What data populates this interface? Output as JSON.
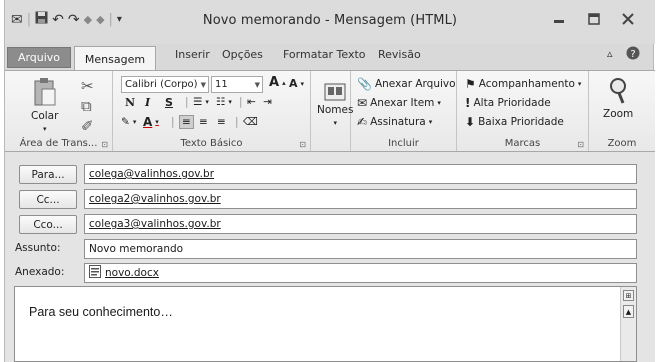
{
  "window": {
    "title": "Novo memorando - Mensagem (HTML)"
  },
  "tabs": {
    "file": "Arquivo",
    "active": "Mensagem",
    "others": [
      "Inserir",
      "Opções",
      "Formatar Texto",
      "Revisão"
    ]
  },
  "ribbon": {
    "clipboard": {
      "paste": "Colar",
      "label": "Área de Trans..."
    },
    "text": {
      "font": "Calibri (Corpo)",
      "size": "11",
      "bold": "N",
      "italic": "I",
      "underline": "S",
      "label": "Texto Básico"
    },
    "names": {
      "label": "Nomes"
    },
    "include": {
      "attach_file": "Anexar Arquivo",
      "attach_item": "Anexar Item",
      "signature": "Assinatura",
      "label": "Incluir"
    },
    "tags": {
      "followup": "Acompanhamento",
      "high": "Alta Prioridade",
      "low": "Baixa Prioridade",
      "label": "Marcas"
    },
    "zoom": {
      "button": "Zoom",
      "label": "Zoom"
    }
  },
  "form": {
    "to_button": "Para...",
    "to_value": "colega@valinhos.gov.br",
    "cc_button": "Cc...",
    "cc_value": "colega2@valinhos.gov.br",
    "bcc_button": "Cco...",
    "bcc_value": "colega3@valinhos.gov.br",
    "subject_label": "Assunto:",
    "subject_value": "Novo memorando",
    "attached_label": "Anexado:",
    "attached_file": "novo.docx"
  },
  "message": {
    "body": "Para seu conhecimento…"
  }
}
